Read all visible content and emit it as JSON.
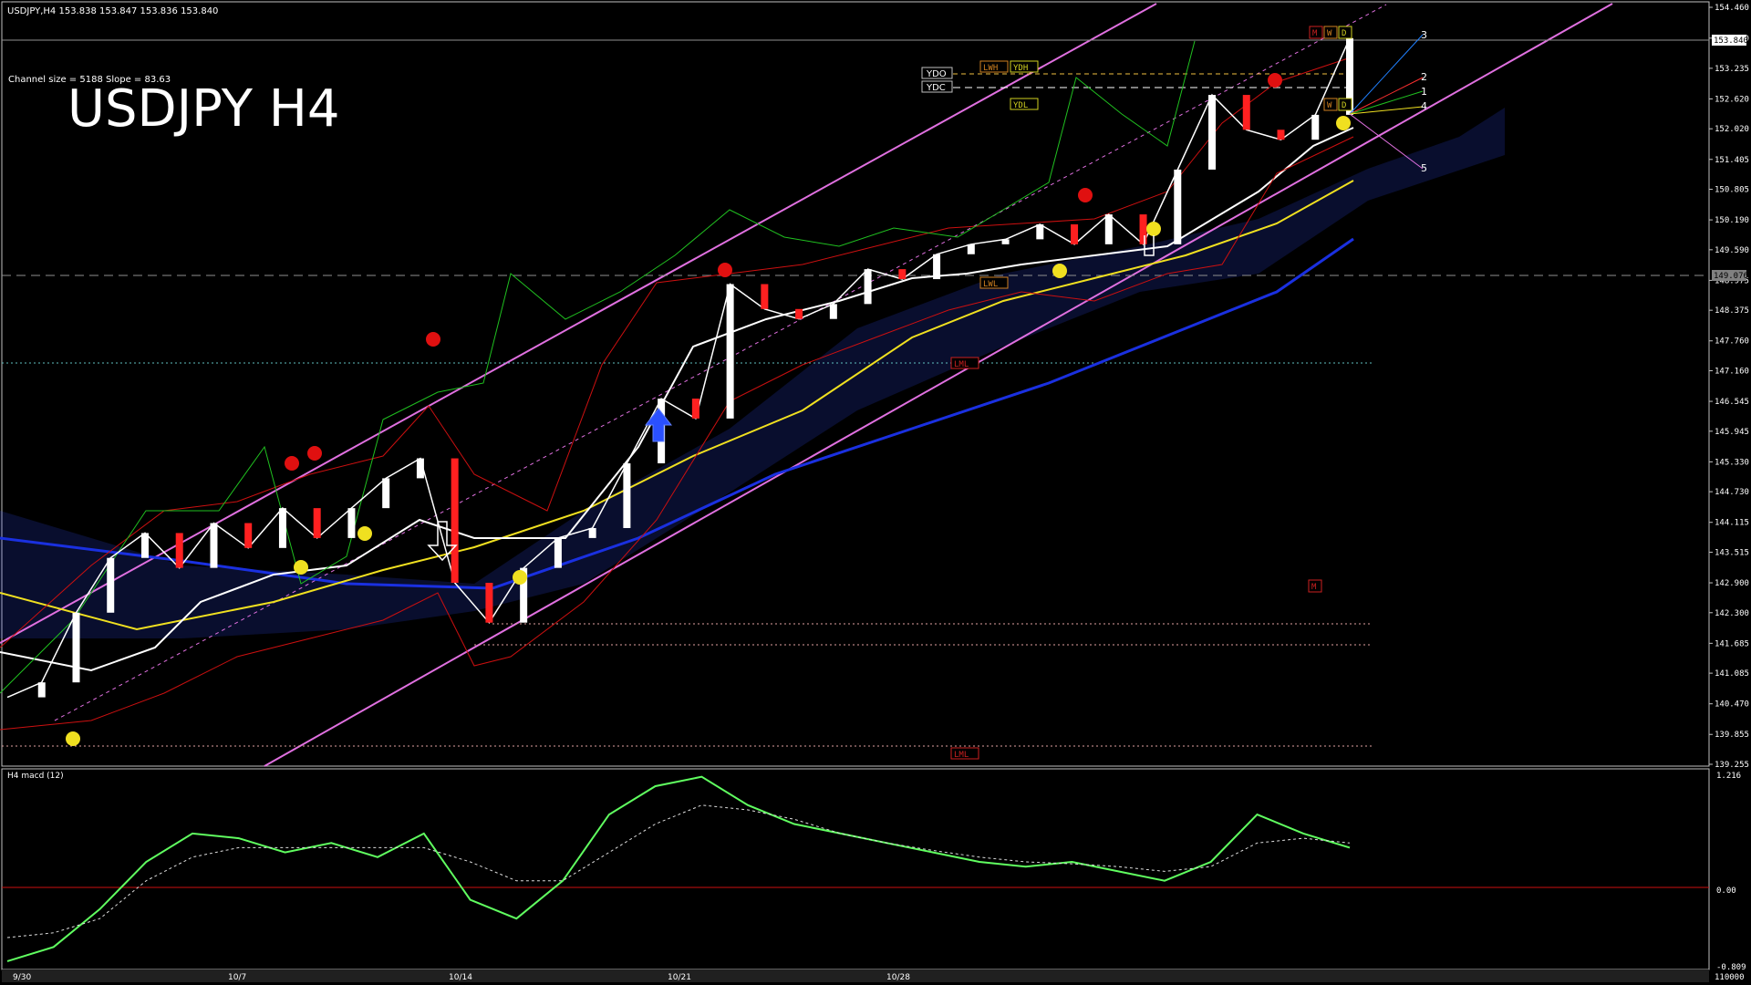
{
  "header": {
    "symbol_info": "USDJPY,H4  153.838 153.847 153.836 153.840",
    "channel_info": "Channel size = 5188  Slope = 83.63",
    "big_title": "USDJPY H4"
  },
  "markers": {
    "ydo": "YDO",
    "ydc": "YDC",
    "lwh": "LWH",
    "ydh": "YDH",
    "ydl": "YDL",
    "lwl": "LWL",
    "lml": "LML",
    "lml2": "LML",
    "m_box": "M",
    "m_top": "M",
    "w_top": "W",
    "d_top": "D",
    "w_mid": "W",
    "d_mid": "D"
  },
  "projection_labels": [
    "3",
    "2",
    "1",
    "4",
    "5"
  ],
  "indicator_title": "H4  macd (12)",
  "colors": {
    "bull_candle": "#ffffff",
    "bear_candle": "#ff2020",
    "channel": "#e070e0",
    "ema_white": "#ffffff",
    "ma_yellow": "#f0e020",
    "ma_blue": "#1a30e0",
    "bollinger": "#cc1010",
    "chikou": "#20c020",
    "cloud": "#3050ff",
    "macd_up": "#60ff60",
    "macd_down": "#ff80a0",
    "signal": "#dddddd",
    "grid_axis": "#c0c0c0",
    "price_marker": "#ffffff"
  },
  "chart_data": [
    {
      "type": "line",
      "title": "USDJPY H4",
      "series": [
        {
          "name": "USDJPY",
          "values": [
            140.6,
            140.9,
            142.3,
            143.4,
            143.9,
            143.2,
            144.1,
            143.6,
            144.4,
            143.8,
            144.4,
            145.0,
            145.4,
            142.9,
            142.1,
            143.2,
            143.8,
            144.0,
            145.3,
            146.6,
            146.2,
            148.9,
            148.4,
            148.2,
            148.5,
            149.2,
            149.0,
            149.5,
            149.7,
            149.8,
            150.1,
            149.7,
            150.3,
            149.7,
            151.2,
            152.7,
            152.0,
            151.8,
            152.3,
            153.84
          ]
        }
      ],
      "x": [
        "9/30",
        "",
        "",
        "",
        "10/7",
        "",
        "",
        "",
        "",
        "10/14",
        "",
        "",
        "",
        "",
        "10/21",
        "",
        "",
        "",
        "",
        "10/28",
        "",
        "",
        "",
        "",
        "",
        "",
        "",
        "",
        "",
        "",
        "",
        "",
        "",
        "",
        "",
        "",
        "",
        "",
        "",
        ""
      ],
      "ylim": [
        139.255,
        154.46
      ],
      "y_ticks": [
        "154.460",
        "153.840",
        "153.235",
        "152.620",
        "152.020",
        "151.405",
        "150.805",
        "150.190",
        "149.590",
        "148.975",
        "148.375",
        "147.760",
        "147.160",
        "146.545",
        "145.945",
        "145.330",
        "144.730",
        "144.115",
        "143.515",
        "142.900",
        "142.300",
        "141.685",
        "141.085",
        "140.470",
        "139.855",
        "139.255"
      ],
      "x_ticks": [
        "9/30",
        "10/7",
        "10/14",
        "10/21",
        "10/28"
      ],
      "current_price": "153.840",
      "ref_price": "149.076"
    },
    {
      "type": "line",
      "title": "H4  macd (12)",
      "series": [
        {
          "name": "macd",
          "values": [
            -0.75,
            -0.6,
            -0.2,
            0.3,
            0.6,
            0.55,
            0.4,
            0.5,
            0.35,
            0.6,
            -0.1,
            -0.3,
            0.1,
            0.8,
            1.1,
            1.2,
            0.9,
            0.7,
            0.6,
            0.5,
            0.4,
            0.3,
            0.25,
            0.3,
            0.2,
            0.1,
            0.3,
            0.8,
            0.6,
            0.45
          ]
        },
        {
          "name": "signal",
          "values": [
            -0.5,
            -0.45,
            -0.3,
            0.1,
            0.35,
            0.45,
            0.45,
            0.45,
            0.45,
            0.45,
            0.3,
            0.1,
            0.1,
            0.4,
            0.7,
            0.9,
            0.85,
            0.75,
            0.6,
            0.5,
            0.42,
            0.35,
            0.3,
            0.28,
            0.25,
            0.2,
            0.25,
            0.5,
            0.55,
            0.5
          ]
        }
      ],
      "ylim": [
        -0.809,
        1.216
      ],
      "y_ticks": [
        "1.216",
        "0.00",
        "-0.809"
      ],
      "extra_tick": "110000"
    }
  ]
}
